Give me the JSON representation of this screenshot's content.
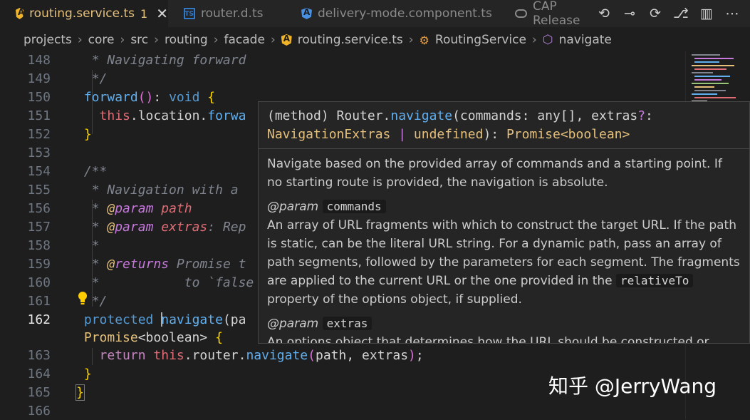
{
  "tabs": [
    {
      "label": "routing.service.ts",
      "badge": "1",
      "icon": "angular-icon",
      "active": true
    },
    {
      "label": "router.d.ts",
      "icon": "typescript-icon"
    },
    {
      "label": "delivery-mode.component.ts",
      "icon": "angular-icon"
    },
    {
      "label": "CAP Release",
      "icon": "cloud-icon"
    }
  ],
  "breadcrumb": {
    "items": [
      "projects",
      "core",
      "src",
      "routing",
      "facade",
      "routing.service.ts",
      "RoutingService",
      "navigate"
    ]
  },
  "line_numbers": [
    "148",
    "149",
    "150",
    "151",
    "152",
    "153",
    "154",
    "155",
    "156",
    "157",
    "158",
    "159",
    "160",
    "161",
    "162",
    "",
    "163",
    "164",
    "165",
    "166"
  ],
  "code": {
    "l148": "* Navigating forward",
    "l149": "*/",
    "l150_kw": "forward",
    "l150_rest": "(): ",
    "l150_void": "void",
    "l151_this": "this",
    "l151_rest": ".location.",
    "l151_fn": "forwa",
    "l155": "* Navigation with a",
    "l156_at": "* @",
    "l156_tag": "param",
    "l156_name": "path",
    "l157_tag": "param",
    "l157_name": "extras",
    "l157_rest": ": Rep",
    "l159_tag": "returns",
    "l159_rest": "Promise t",
    "l160_rest": "to `false",
    "l162_kw": "protected",
    "l162_fn": "navigate",
    "l162_rest": "(pa",
    "l162b_ty": "Promise",
    "l162b_rest": "<boolean>",
    "l163_kw": "return",
    "l163_this": "this",
    "l163_router": ".router.",
    "l163_fn": "navigate",
    "l163_args": "path, extras"
  },
  "hover": {
    "sig_prefix": "(method) Router.",
    "sig_fn": "navigate",
    "sig_params": "(commands: any[], extras",
    "sig_opt": "?",
    "sig_colon": ":",
    "sig_type1": "NavigationExtras",
    "sig_pipe": " | ",
    "sig_undef": "undefined",
    "sig_ret_sep": "): ",
    "sig_ret": "Promise",
    "sig_ret_gen": "<boolean>",
    "description": "Navigate based on the provided array of commands and a starting point. If no starting route is provided, the navigation is absolute.",
    "param1_tag": "@param",
    "param1_name": "commands",
    "param1_desc_a": "An array of URL fragments with which to construct the target URL. If the path is static, can be the literal URL string. For a dynamic path, pass an array of path segments, followed by the parameters for each segment. The fragments are applied to the current URL or the one provided in the",
    "param1_chip": "relativeTo",
    "param1_desc_b": "property of the options object, if supplied.",
    "param2_tag": "@param",
    "param2_name": "extras",
    "param2_desc": "An options object that determines how the URL should be constructed or"
  },
  "watermark": "知乎 @JerryWang"
}
